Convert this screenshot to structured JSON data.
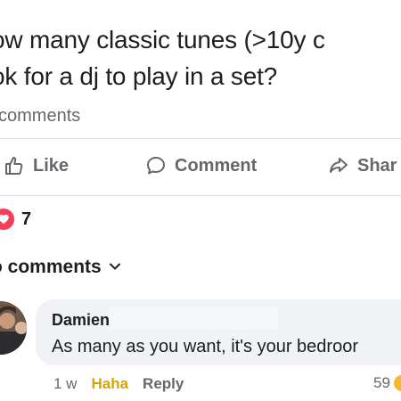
{
  "post": {
    "text_line1": "ow many classic tunes (>10y c",
    "text_line2": "ok for a dj to play in a set?",
    "comment_count": "comments"
  },
  "actions": {
    "like_label": "Like",
    "comment_label": "Comment",
    "share_label": "Shar"
  },
  "reactions": {
    "count": "7",
    "icon": "heart-icon",
    "color": "#f33e58"
  },
  "top_comments": {
    "label": "o comments",
    "icon": "chevron-down-icon"
  },
  "comment": {
    "author": "Damien",
    "text": "As many as you want, it's your bedroor",
    "time": "1 w",
    "haha_label": "Haha",
    "reply_label": "Reply",
    "reaction_count": "59"
  },
  "colors": {
    "text": "#1c1e21",
    "secondary": "#65676b",
    "bubble": "#f0f2f5",
    "haha": "#d9a400"
  }
}
